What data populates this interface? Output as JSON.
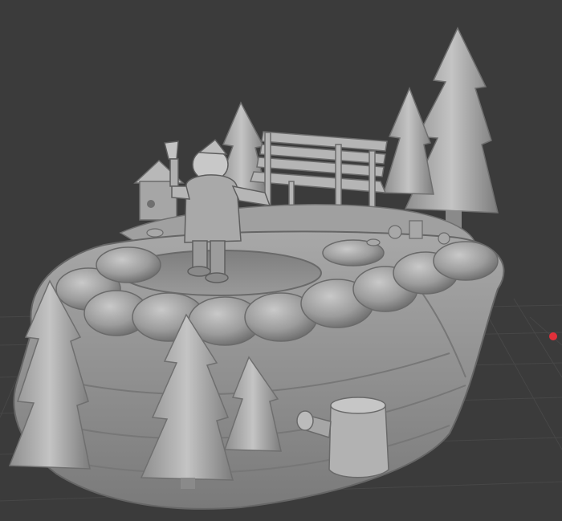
{
  "viewport": {
    "background": "#3b3b3b",
    "grid_color": "#4a4a4a",
    "model_color": "#a9a9a9",
    "model_shadow": "#5e5e5e",
    "marker_color": "#e0303a"
  },
  "scene": {
    "model_name": "winter-diorama-with-santa",
    "elements": [
      "santa-figure",
      "park-bench",
      "birdhouse",
      "pine-trees",
      "tree-stump",
      "frozen-pond"
    ]
  }
}
